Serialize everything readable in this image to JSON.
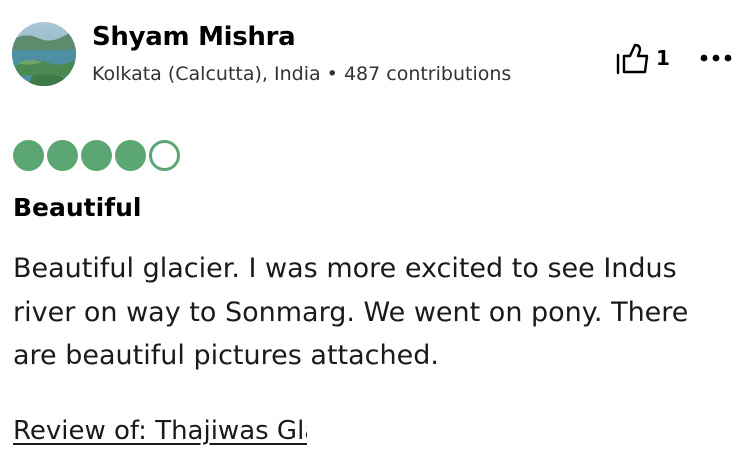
{
  "user": {
    "name": "Shyam Mishra",
    "location": "Kolkata (Calcutta), India",
    "separator": "•",
    "contributions": "487 contributions"
  },
  "helpful": {
    "icon": "thumbs-up-icon",
    "count": "1"
  },
  "menu": {
    "icon": "more-options-icon"
  },
  "rating": {
    "value": 4,
    "max": 5,
    "color": "#5ba672"
  },
  "review": {
    "title": "Beautiful",
    "body": "Beautiful glacier. I was more excited to see Indus river on way to Sonmarg. We went on pony. There are beautiful pictures attached.",
    "review_of": "Review of: Thajiwas Glacier"
  }
}
